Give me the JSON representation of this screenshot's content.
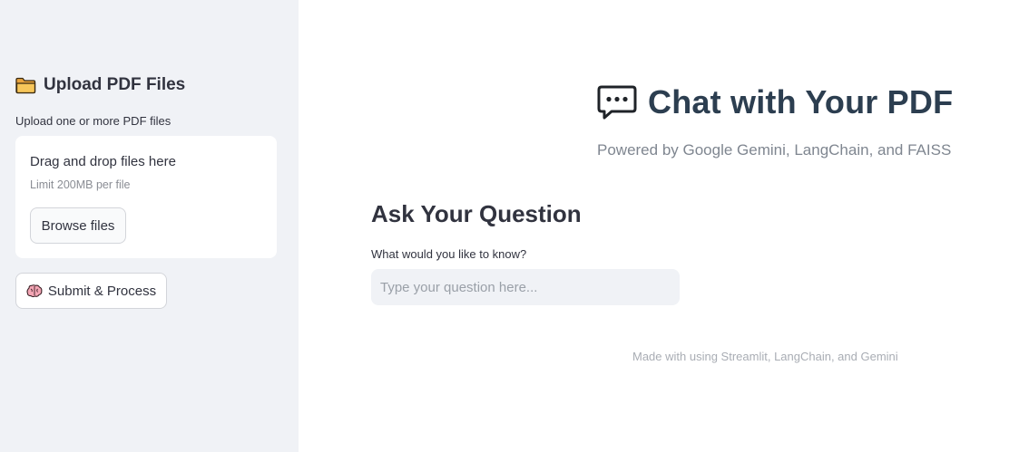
{
  "sidebar": {
    "title": "Upload PDF Files",
    "title_icon": "folder-icon",
    "upload_label": "Upload one or more PDF files",
    "dropzone": {
      "drop_text": "Drag and drop files here",
      "limit_text": "Limit 200MB per file",
      "browse_label": "Browse files"
    },
    "submit_label": "Submit & Process",
    "submit_icon": "brain-icon"
  },
  "main": {
    "title": "Chat with Your PDF",
    "title_icon": "speech-bubble-icon",
    "subtitle": "Powered by Google Gemini, LangChain, and FAISS",
    "section_title": "Ask Your Question",
    "question_label": "What would you like to know?",
    "question_placeholder": "Type your question here...",
    "question_value": "",
    "footer": "Made with using Streamlit, LangChain, and Gemini"
  },
  "colors": {
    "sidebar_bg": "#f0f2f6",
    "title_color": "#2c3e50",
    "text_color": "#31333f",
    "muted_text": "#7f8690"
  }
}
